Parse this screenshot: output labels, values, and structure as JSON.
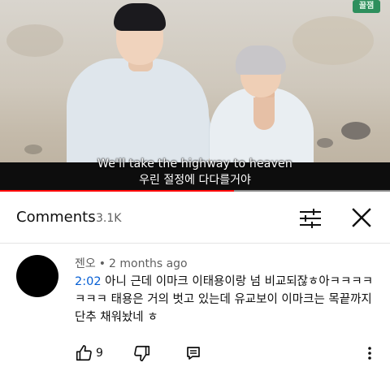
{
  "video": {
    "channel_logo_text": "꿀잼",
    "subtitle_en": "We'll take the highway to heaven",
    "subtitle_ko": "우린 절정에 다다를거야",
    "progress_fraction": 0.6,
    "progress_color": "#ff0000"
  },
  "comments_panel": {
    "title": "Comments",
    "count": "3.1K",
    "filter_icon": "sliders-icon",
    "close_icon": "close-icon"
  },
  "comment": {
    "author": "젠오",
    "separator": "•",
    "time": "2 months ago",
    "timestamp_link": "2:02",
    "text": " 아니 근데 이마크 이태용이랑 넘 비교되잖ㅎ아ㅋㅋㅋㅋㅋㅋㅋ 태용은 거의 벗고 있는데 유교보이 이마크는 목끝까지 단추 채워놨네 ㅎ",
    "like_count": "9",
    "accent_color": "#065fd4"
  }
}
